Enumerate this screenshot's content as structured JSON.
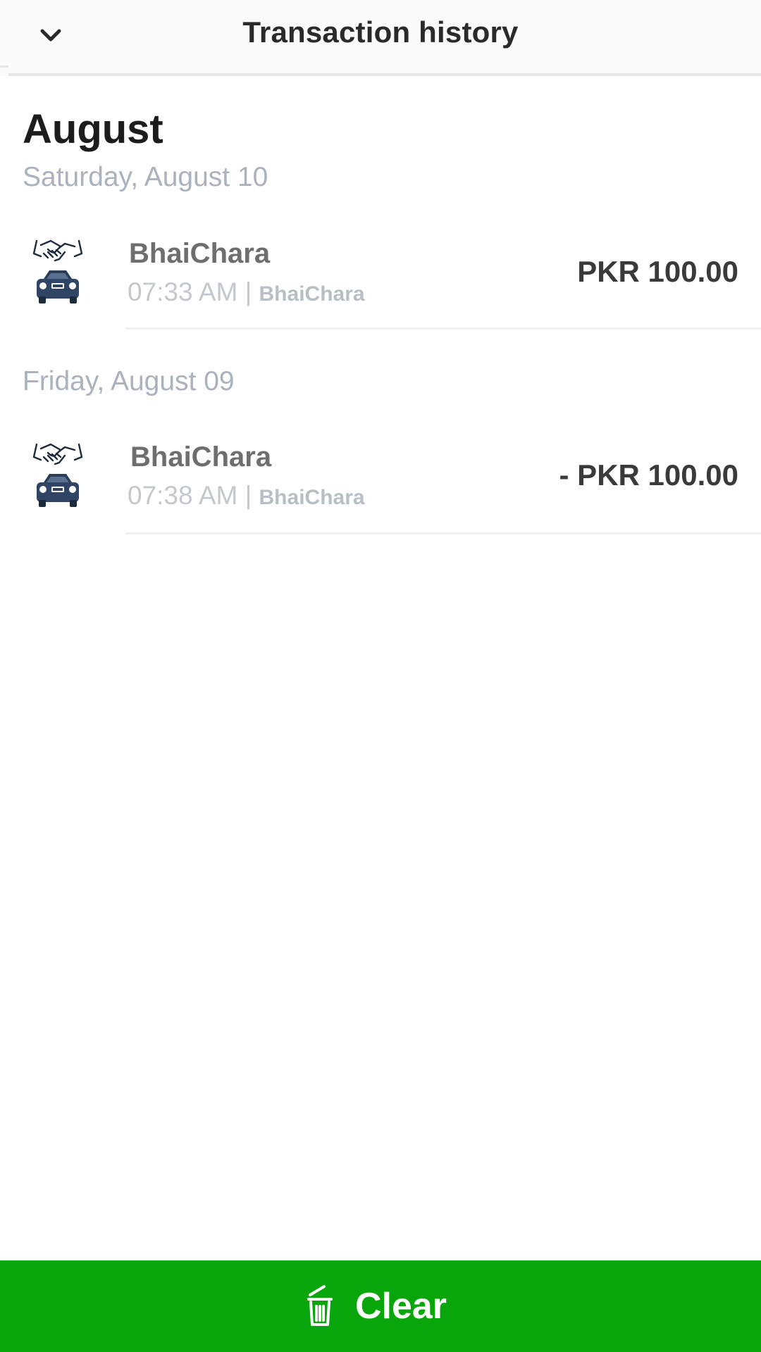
{
  "header": {
    "title": "Transaction history",
    "back_icon": "chevron-down-icon"
  },
  "month": "August",
  "groups": [
    {
      "day": "Saturday, August 10",
      "transactions": [
        {
          "name": "BhaiChara",
          "time": "07:33 AM |",
          "source": "BhaiChara",
          "amount": "PKR 100.00",
          "icon": "handshake-car-icon"
        }
      ]
    },
    {
      "day": "Friday, August 09",
      "transactions": [
        {
          "name": "BhaiChara",
          "time": "07:38 AM |",
          "source": "BhaiChara",
          "amount": "- PKR 100.00",
          "icon": "handshake-car-icon"
        }
      ]
    }
  ],
  "footer": {
    "clear_label": "Clear",
    "clear_icon": "trash-icon",
    "accent_color": "#09a60b"
  }
}
